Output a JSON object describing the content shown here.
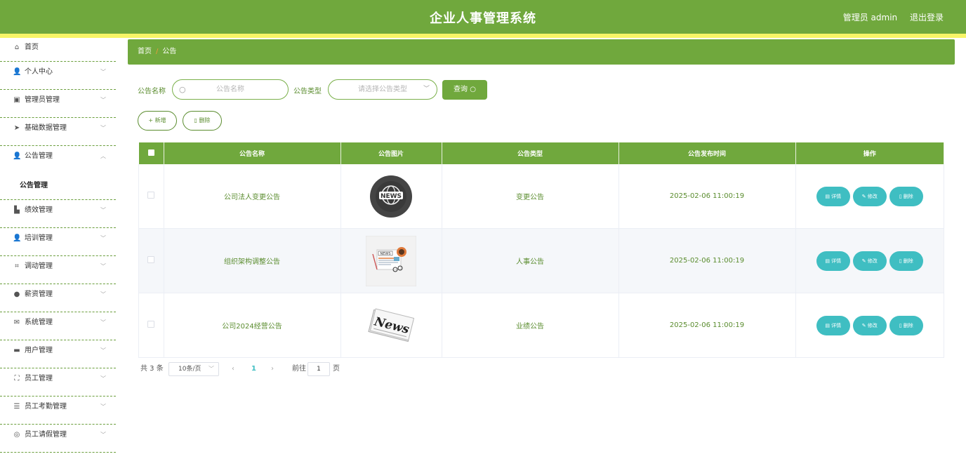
{
  "header": {
    "title": "企业人事管理系统",
    "user_label": "管理员 admin",
    "logout_label": "退出登录"
  },
  "sidebar": {
    "items": [
      {
        "label": "首页",
        "icon": "home-icon",
        "glyph": "⌂"
      },
      {
        "label": "个人中心",
        "icon": "person-icon",
        "glyph": "👤"
      },
      {
        "label": "管理员管理",
        "icon": "clipboard-icon",
        "glyph": "▣"
      },
      {
        "label": "基础数据管理",
        "icon": "send-icon",
        "glyph": "➤"
      },
      {
        "label": "公告管理",
        "icon": "user-group-icon",
        "glyph": "👤"
      },
      {
        "label": "绩效管理",
        "icon": "thumb-up-icon",
        "glyph": "▙"
      },
      {
        "label": "培训管理",
        "icon": "person-icon",
        "glyph": "👤"
      },
      {
        "label": "调动管理",
        "icon": "crop-icon",
        "glyph": "⌗"
      },
      {
        "label": "薪资管理",
        "icon": "location-icon",
        "glyph": "●"
      },
      {
        "label": "系统管理",
        "icon": "mail-icon",
        "glyph": "✉"
      },
      {
        "label": "用户管理",
        "icon": "ticket-icon",
        "glyph": "▬"
      },
      {
        "label": "员工管理",
        "icon": "fullscreen-icon",
        "glyph": "⛶"
      },
      {
        "label": "员工考勤管理",
        "icon": "sliders-icon",
        "glyph": "☰"
      },
      {
        "label": "员工请假管理",
        "icon": "globe-icon",
        "glyph": "◎"
      }
    ],
    "open_submenu": {
      "label": "公告管理"
    }
  },
  "breadcrumb": {
    "home": "首页",
    "sep": "/",
    "current": "公告"
  },
  "search": {
    "name_label": "公告名称",
    "name_placeholder": "公告名称",
    "type_label": "公告类型",
    "type_placeholder": "请选择公告类型",
    "query_label": "查询"
  },
  "actions": {
    "add_label": "新增",
    "delete_label": "删除"
  },
  "table": {
    "headers": [
      "公告名称",
      "公告图片",
      "公告类型",
      "公告发布时间",
      "操作"
    ],
    "rows": [
      {
        "name": "公司法人变更公告",
        "image": "news-globe-badge",
        "type": "变更公告",
        "time": "2025-02-06 11:00:19"
      },
      {
        "name": "组织架构调整公告",
        "image": "newspaper-coffee",
        "type": "人事公告",
        "time": "2025-02-06 11:00:19"
      },
      {
        "name": "公司2024经营公告",
        "image": "news-paper-stack",
        "type": "业绩公告",
        "time": "2025-02-06 11:00:19"
      }
    ],
    "op_labels": {
      "detail": "详情",
      "edit": "修改",
      "delete": "删除"
    }
  },
  "pagination": {
    "total_text": "共 3 条",
    "page_size": "10条/页",
    "current_page": "1",
    "goto_label": "前往",
    "goto_value": "1",
    "page_suffix": "页"
  },
  "colors": {
    "primary": "#70a83d",
    "accent_stripe": "#f7f567",
    "teal": "#3fbec2"
  }
}
